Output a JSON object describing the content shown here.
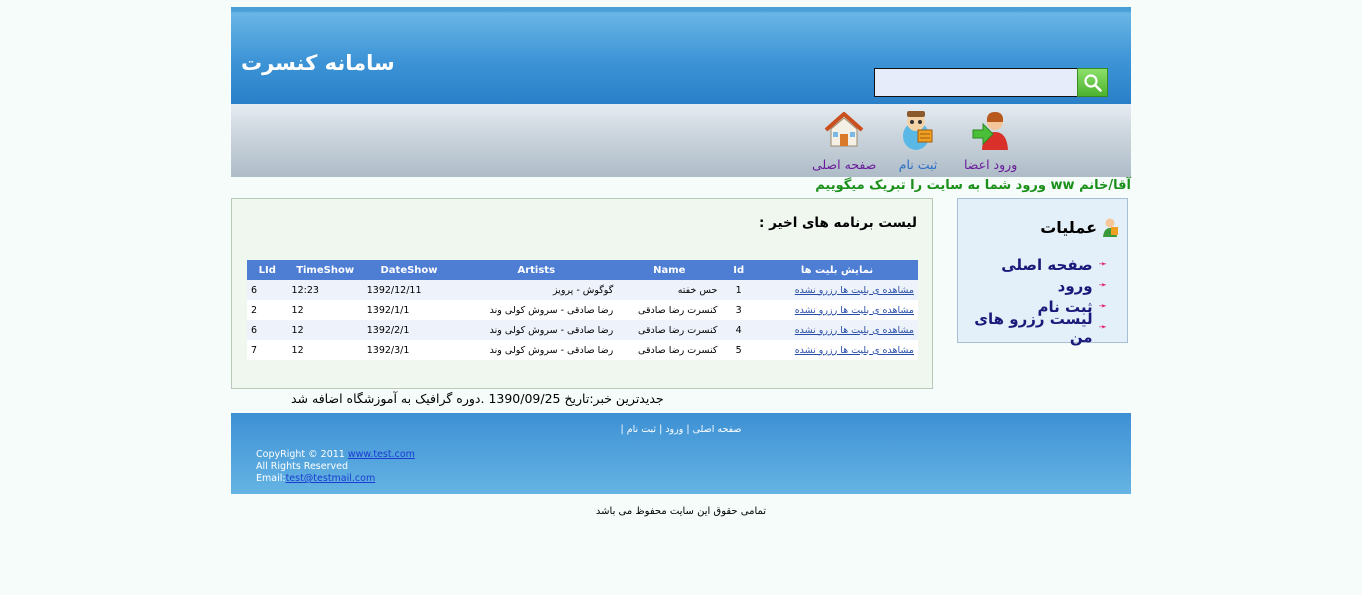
{
  "header": {
    "site_title": "سامانه کنسرت",
    "search_value": ""
  },
  "nav": {
    "items": [
      {
        "label": "ورود اعضا",
        "icon": "member-login-icon"
      },
      {
        "label": "ثبت نام",
        "icon": "register-icon"
      },
      {
        "label": "صفحه اصلی",
        "icon": "home-icon"
      }
    ]
  },
  "welcome": "آقا/خانم ww ورود شما به سایت را تبریک میگوییم",
  "main": {
    "list_title": "لیست برنامه های اخیر :",
    "columns": [
      "نمایش بلیت ها",
      "Id",
      "Name",
      "Artists",
      "DateShow",
      "TimeShow",
      "LId"
    ],
    "rows": [
      {
        "link": "مشاهده ی بلیت ها رزرو نشده",
        "id": "1",
        "name": "حس خفته",
        "artists": "گوگوش - پرویز",
        "date": "1392/12/11",
        "time": "12:23",
        "lid": "6"
      },
      {
        "link": "مشاهده ی بلیت ها رزرو نشده",
        "id": "3",
        "name": "کنسرت رضا صادقی",
        "artists": "رضا صادقی - سروش کولی وند",
        "date": "1392/1/1",
        "time": "12",
        "lid": "2"
      },
      {
        "link": "مشاهده ی بلیت ها رزرو نشده",
        "id": "4",
        "name": "کنسرت رضا صادقی",
        "artists": "رضا صادقی - سروش کولی وند",
        "date": "1392/2/1",
        "time": "12",
        "lid": "6"
      },
      {
        "link": "مشاهده ی بلیت ها رزرو نشده",
        "id": "5",
        "name": "کنسرت رضا صادقی",
        "artists": "رضا صادقی - سروش کولی وند",
        "date": "1392/3/1",
        "time": "12",
        "lid": "7"
      }
    ],
    "news": "جدیدترین خبر:تاریخ 1390/09/25 .دوره گرافیک به آموزشگاه اضافه شد"
  },
  "side": {
    "title": "عملیات",
    "items": [
      "صفحه اصلی",
      "ورود",
      "ثبت نام",
      "لیست رزرو های من"
    ]
  },
  "footer": {
    "links": [
      "صفحه اصلی",
      "ورود",
      "ثبت نام"
    ],
    "copyright_text": "CopyRight © 2011",
    "copyright_link": "www.test.com",
    "rights_reserved": "All Rights Reserved",
    "email_label": "Email:",
    "email": "test@testmail.com",
    "site_rights": "تمامی حقوق این سایت محفوظ می باشد"
  },
  "colors": {
    "header_blue": "#3d94d6",
    "table_header": "#4e7dd4",
    "welcome_green": "#1a8f1a",
    "bullet_pink": "#e0106e"
  }
}
